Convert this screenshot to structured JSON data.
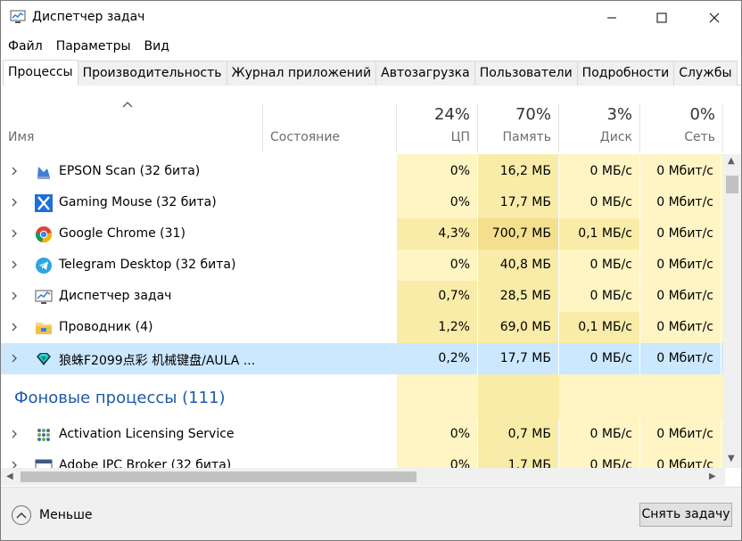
{
  "window": {
    "title": "Диспетчер задач"
  },
  "menu": [
    "Файл",
    "Параметры",
    "Вид"
  ],
  "tabs": [
    "Процессы",
    "Производительность",
    "Журнал приложений",
    "Автозагрузка",
    "Пользователи",
    "Подробности",
    "Службы"
  ],
  "columns": {
    "name": "Имя",
    "status": "Состояние",
    "cpu": {
      "percent": "24%",
      "label": "ЦП"
    },
    "memory": {
      "percent": "70%",
      "label": "Память"
    },
    "disk": {
      "percent": "3%",
      "label": "Диск"
    },
    "network": {
      "percent": "0%",
      "label": "Сеть"
    }
  },
  "apps": [
    {
      "name": "EPSON Scan (32 бита)",
      "icon": "epson-scan-icon",
      "cpu": "0%",
      "mem": "16,2 МБ",
      "disk": "0 МБ/с",
      "net": "0 Мбит/с"
    },
    {
      "name": "Gaming Mouse (32 бита)",
      "icon": "gaming-mouse-icon",
      "cpu": "0%",
      "mem": "17,7 МБ",
      "disk": "0 МБ/с",
      "net": "0 Мбит/с"
    },
    {
      "name": "Google Chrome (31)",
      "icon": "chrome-icon",
      "cpu": "4,3%",
      "mem": "700,7 МБ",
      "disk": "0,1 МБ/с",
      "net": "0 Мбит/с"
    },
    {
      "name": "Telegram Desktop (32 бита)",
      "icon": "telegram-icon",
      "cpu": "0%",
      "mem": "40,8 МБ",
      "disk": "0 МБ/с",
      "net": "0 Мбит/с"
    },
    {
      "name": "Диспетчер задач",
      "icon": "task-manager-icon",
      "cpu": "0,7%",
      "mem": "28,5 МБ",
      "disk": "0 МБ/с",
      "net": "0 Мбит/с"
    },
    {
      "name": "Проводник (4)",
      "icon": "explorer-folder-icon",
      "cpu": "1,2%",
      "mem": "69,0 МБ",
      "disk": "0,1 МБ/с",
      "net": "0 Мбит/с"
    },
    {
      "name": "狼蛛F2099点彩 机械键盘/AULA ...",
      "icon": "keyboard-gem-icon",
      "cpu": "0,2%",
      "mem": "17,7 МБ",
      "disk": "0 МБ/с",
      "net": "0 Мбит/с"
    }
  ],
  "background_section": {
    "title": "Фоновые процессы (111)"
  },
  "background": [
    {
      "name": "Activation Licensing Service",
      "icon": "activation-dots-icon",
      "cpu": "0%",
      "mem": "0,7 МБ",
      "disk": "0 МБ/с",
      "net": "0 Мбит/с"
    },
    {
      "name": "Adobe IPC Broker (32 бита)",
      "icon": "window-app-icon",
      "cpu": "0%",
      "mem": "1,7 МБ",
      "disk": "0 МБ/с",
      "net": "0 Мбит/с"
    }
  ],
  "footer": {
    "less_label": "Меньше",
    "end_task_label": "Снять задачу"
  },
  "colors": {
    "heat_light": "#fff4c4",
    "heat_mid": "#f9eca8",
    "heat_dark": "#f3df8e",
    "selected": "#cce8ff",
    "section": "#1e5aa8"
  }
}
